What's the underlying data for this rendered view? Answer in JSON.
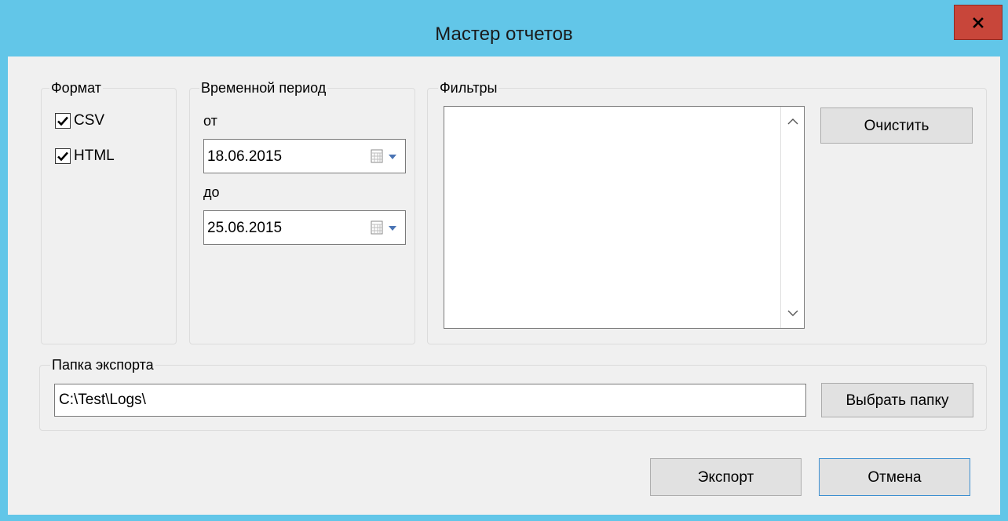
{
  "window": {
    "title": "Мастер отчетов",
    "close_glyph": "x"
  },
  "format": {
    "legend": "Формат",
    "options": [
      {
        "label": "CSV",
        "checked": true
      },
      {
        "label": "HTML",
        "checked": true
      }
    ]
  },
  "period": {
    "legend": "Временной период",
    "from_label": "от",
    "from_value": "18.06.2015",
    "to_label": "до",
    "to_value": "25.06.2015"
  },
  "filters": {
    "legend": "Фильтры",
    "clear_label": "Очистить"
  },
  "export_folder": {
    "legend": "Папка экспорта",
    "path": "C:\\Test\\Logs\\",
    "browse_label": "Выбрать папку"
  },
  "actions": {
    "export_label": "Экспорт",
    "cancel_label": "Отмена"
  },
  "colors": {
    "titlebar": "#62c6e8",
    "close": "#c8463a",
    "client": "#f0f0f0",
    "focus_border": "#3c8fd0"
  }
}
